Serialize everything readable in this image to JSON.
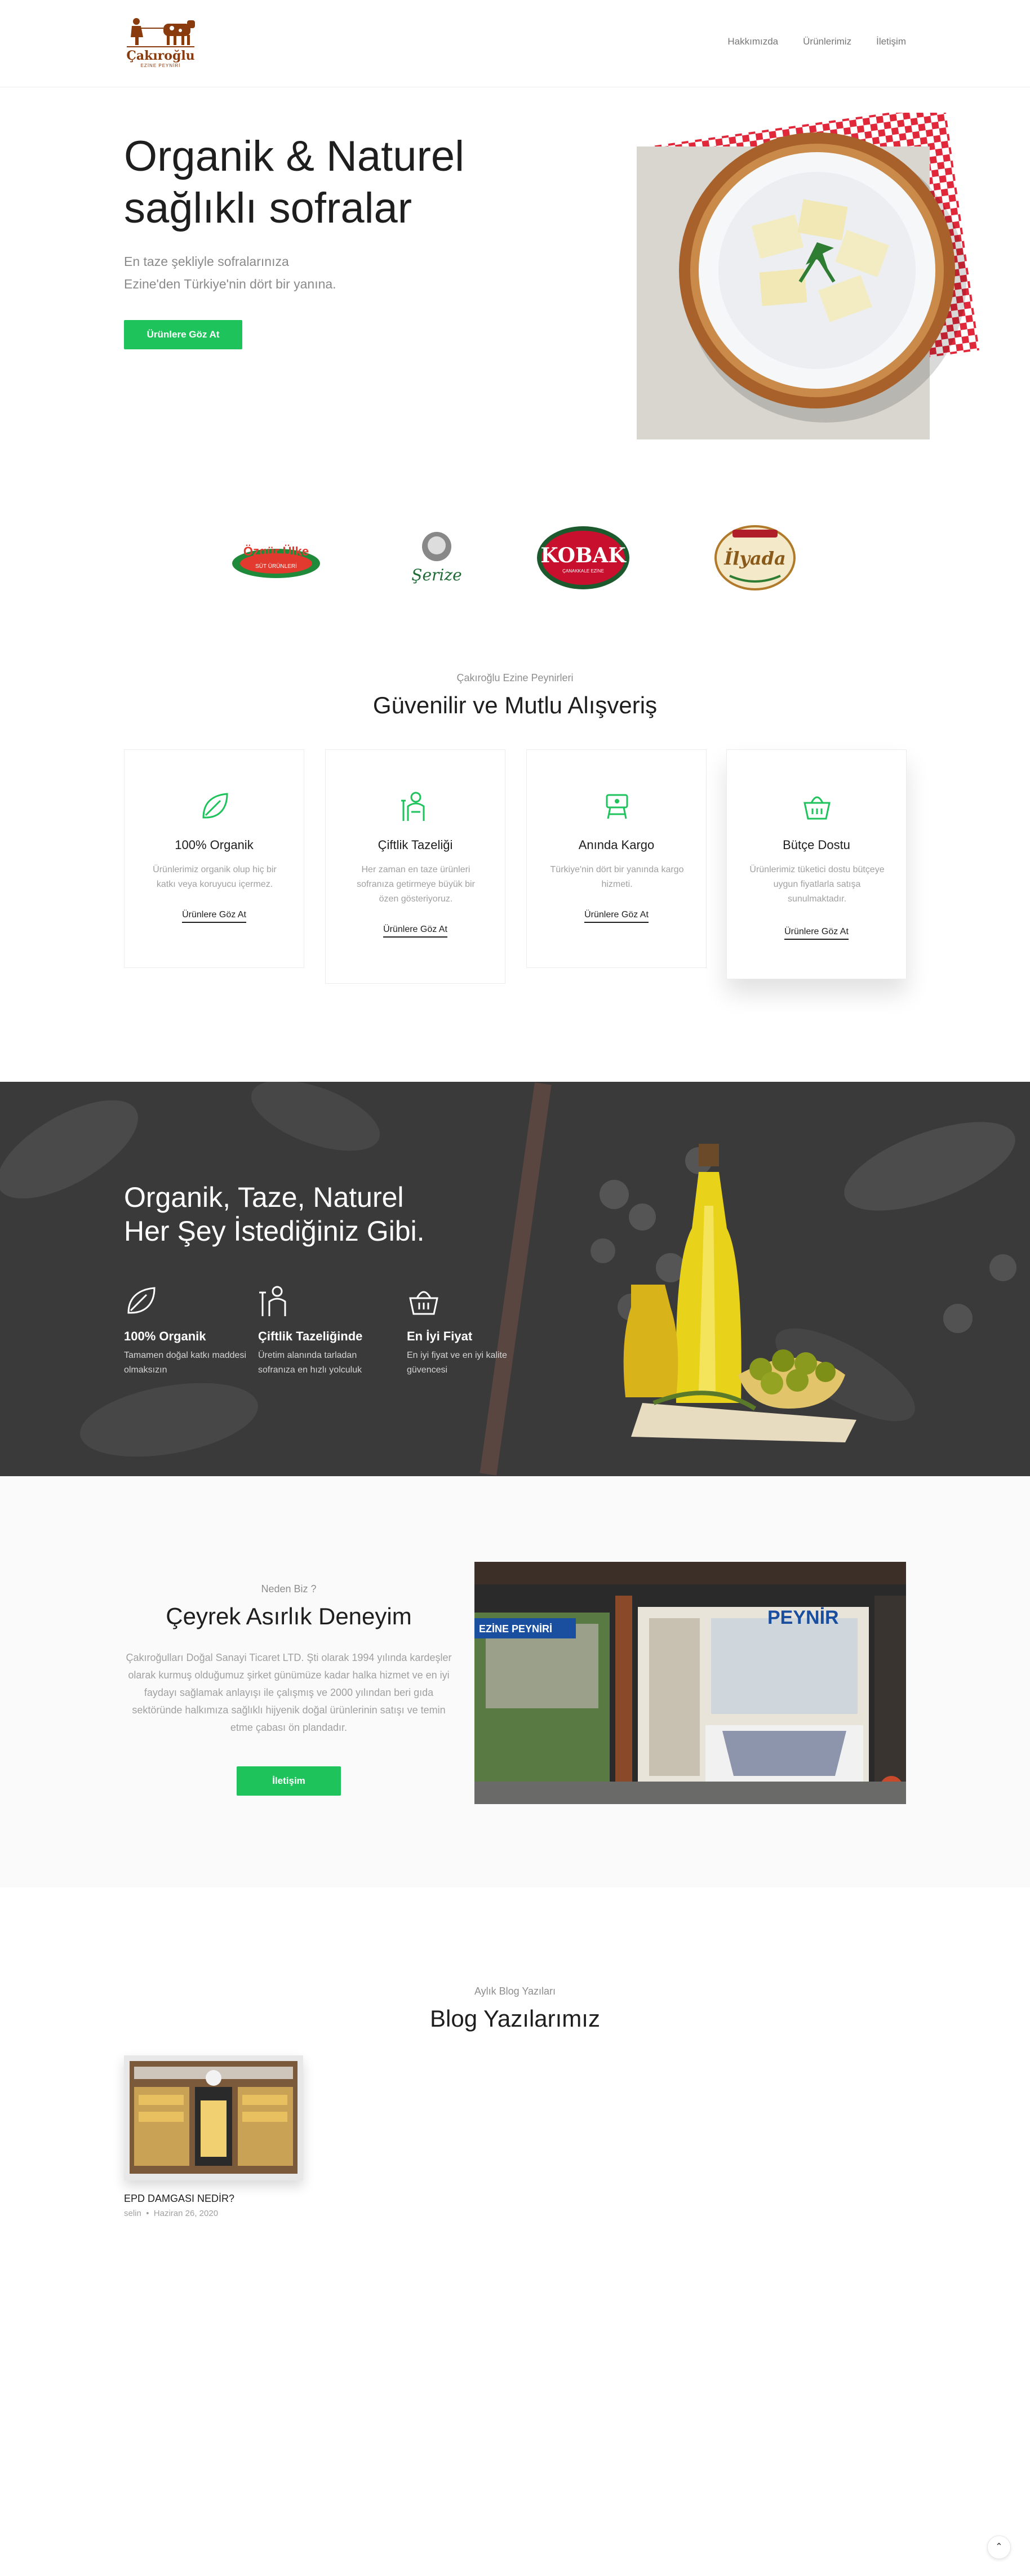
{
  "header": {
    "logo_text": "Çakıroğlu",
    "logo_sub": "EZİNE PEYNİRİ",
    "nav": [
      "Hakkımızda",
      "Ürünlerimiz",
      "İletişim"
    ]
  },
  "hero": {
    "title_line1": "Organik & Naturel",
    "title_line2": "sağlıklı sofralar",
    "subtitle_line1": "En taze şekliyle sofralarınıza",
    "subtitle_line2": "Ezine'den Türkiye'nin dört bir yanına.",
    "button": "Ürünlere Göz At"
  },
  "brands": [
    {
      "name": "Özgür Ülke",
      "sub": "SÜT ÜRÜNLERİ"
    },
    {
      "name": "Şerize"
    },
    {
      "name": "KOBAK",
      "sub": "ÇANAKKALE EZİNE"
    },
    {
      "name": "İlyada"
    }
  ],
  "features": {
    "kicker": "Çakıroğlu Ezine Peynirleri",
    "title": "Güvenilir ve Mutlu Alışveriş",
    "cards": [
      {
        "icon": "leaf-icon",
        "title": "100% Organik",
        "desc": "Ürünlerimiz organik olup hiç bir katkı veya koruyucu içermez.",
        "link": "Ürünlere Göz At"
      },
      {
        "icon": "farmer-icon",
        "title": "Çiftlik Tazeliği",
        "desc": "Her zaman en taze ürünleri sofranıza getirmeye büyük bir özen gösteriyoruz.",
        "link": "Ürünlere Göz At"
      },
      {
        "icon": "delivery-icon",
        "title": "Anında Kargo",
        "desc": "Türkiye'nin dört bir yanında kargo hizmeti.",
        "link": "Ürünlere Göz At"
      },
      {
        "icon": "basket-icon",
        "title": "Bütçe Dostu",
        "desc": "Ürünlerimiz tüketici dostu bütçeye uygun fiyatlarla satışa sunulmaktadır.",
        "link": "Ürünlere Göz At"
      }
    ]
  },
  "band": {
    "title_line1": "Organik, Taze, Naturel",
    "title_line2": "Her Şey İstediğiniz Gibi.",
    "items": [
      {
        "icon": "leaf-icon",
        "title": "100% Organik",
        "desc": "Tamamen doğal katkı maddesi olmaksızın"
      },
      {
        "icon": "farmer-icon",
        "title": "Çiftlik Tazeliğinde",
        "desc": "Üretim alanında tarladan sofranıza en hızlı yolculuk"
      },
      {
        "icon": "basket-icon",
        "title": "En İyi Fiyat",
        "desc": "En iyi fiyat ve en iyi kalite güvencesi"
      }
    ]
  },
  "about": {
    "kicker": "Neden Biz ?",
    "title": "Çeyrek Asırlık Deneyim",
    "text": "Çakıroğulları Doğal Sanayi Ticaret LTD. Şti olarak 1994 yılında kardeşler olarak kurmuş olduğumuz şirket günümüze kadar halka hizmet ve en iyi faydayı sağlamak anlayışı ile çalışmış ve 2000 yılından beri gıda sektöründe halkımıza sağlıklı hijyenik doğal ürünlerinin satışı ve temin etme çabası ön plandadır.",
    "button": "İletişim",
    "shop_sign_1": "EZİNE PEYNİRİ",
    "shop_sign_2": "PEYNİR"
  },
  "blog": {
    "kicker": "Aylık Blog Yazıları",
    "title": "Blog Yazılarımız",
    "posts": [
      {
        "title": "EPD DAMGASI NEDİR?",
        "author": "selin",
        "date": "Haziran 26, 2020"
      }
    ]
  },
  "colors": {
    "accent": "#1ec35c",
    "brand_brown": "#8a3b0e",
    "band_bg": "#3c3c3c"
  }
}
